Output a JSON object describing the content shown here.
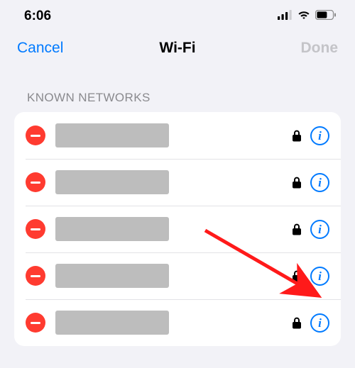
{
  "status": {
    "time": "6:06"
  },
  "nav": {
    "cancel": "Cancel",
    "title": "Wi-Fi",
    "done": "Done"
  },
  "section": {
    "header": "KNOWN NETWORKS"
  },
  "info_glyph": "i",
  "colors": {
    "accent": "#007aff",
    "destructive": "#ff3b30",
    "disabled": "#c4c4c8",
    "background": "#f2f2f7"
  },
  "networks": [
    {
      "name_redacted": true,
      "secured": true
    },
    {
      "name_redacted": true,
      "secured": true
    },
    {
      "name_redacted": true,
      "secured": true
    },
    {
      "name_redacted": true,
      "secured": true
    },
    {
      "name_redacted": true,
      "secured": true
    }
  ],
  "annotation": {
    "arrow_target_row_index": 3
  }
}
